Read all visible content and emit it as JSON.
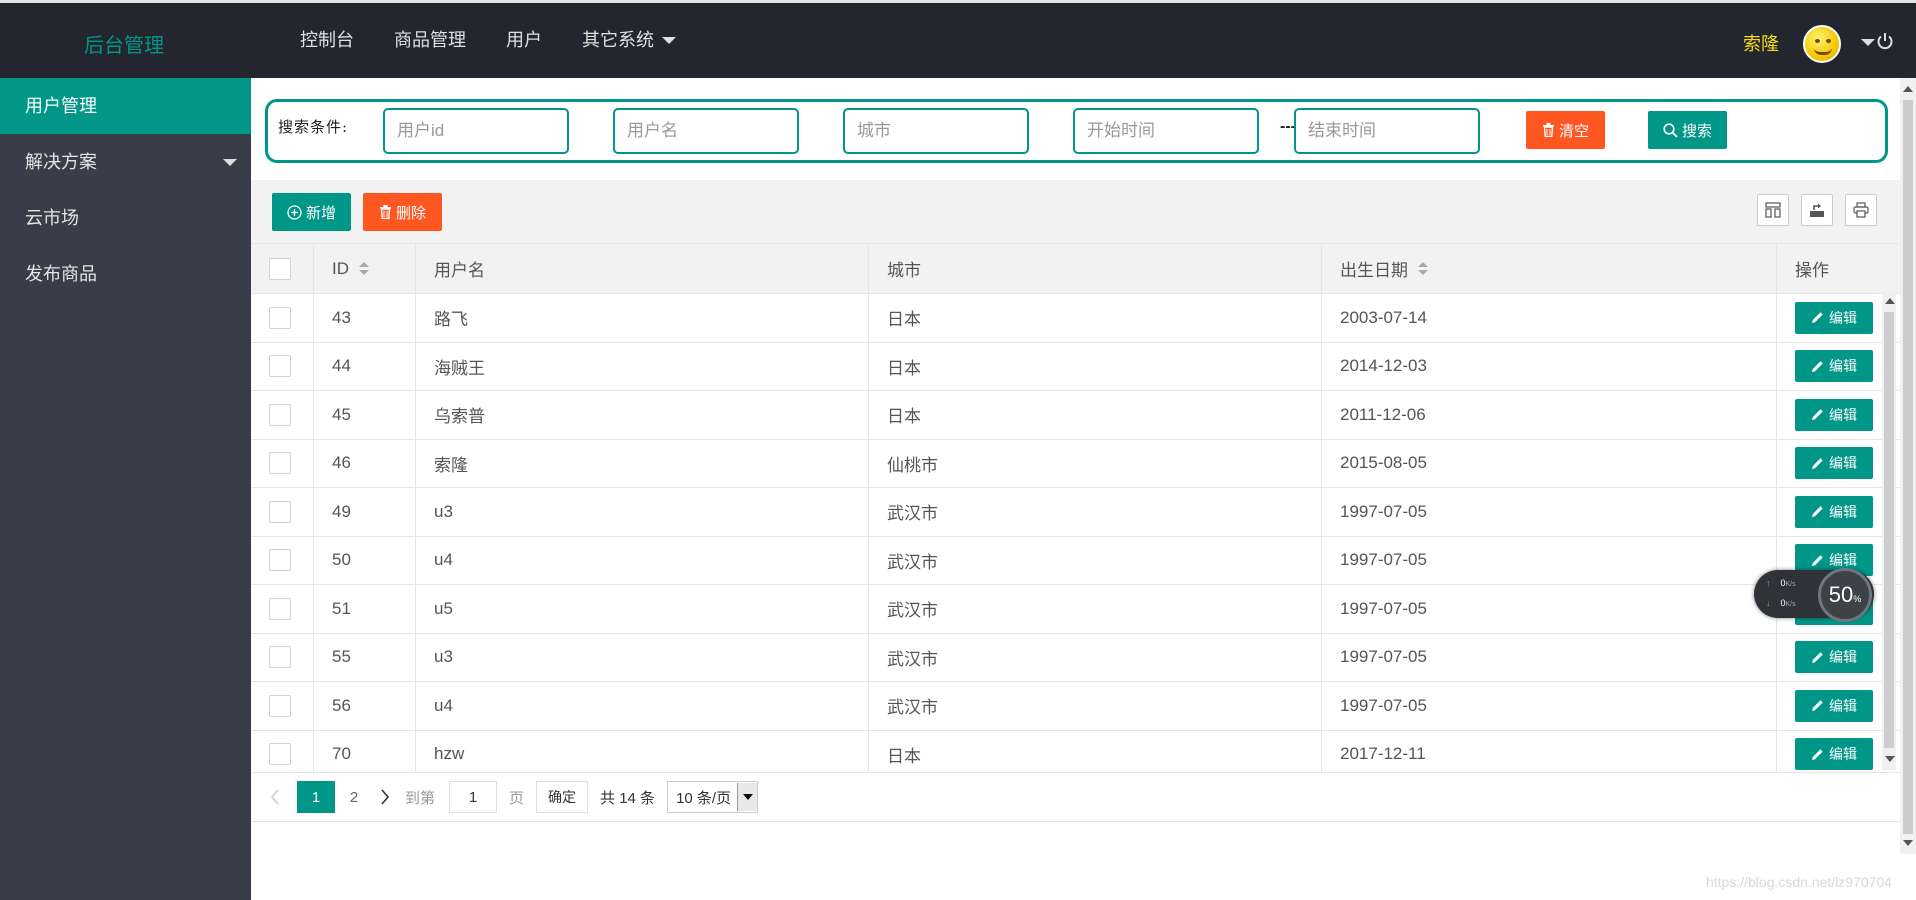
{
  "header": {
    "logo": "后台管理",
    "nav": [
      {
        "label": "控制台"
      },
      {
        "label": "商品管理"
      },
      {
        "label": "用户"
      },
      {
        "label": "其它系统",
        "has_dropdown": true
      }
    ],
    "user_name": "索隆"
  },
  "sidebar": {
    "items": [
      {
        "label": "用户管理",
        "active": true
      },
      {
        "label": "解决方案",
        "has_dropdown": true
      },
      {
        "label": "云市场"
      },
      {
        "label": "发布商品"
      }
    ]
  },
  "search": {
    "label": "搜索条件:",
    "user_id_placeholder": "用户id",
    "username_placeholder": "用户名",
    "city_placeholder": "城市",
    "start_time_placeholder": "开始时间",
    "separator": "----",
    "end_time_placeholder": "结束时间",
    "clear_label": "清空",
    "search_label": "搜索"
  },
  "toolbar": {
    "add_label": "新增",
    "delete_label": "删除"
  },
  "table": {
    "columns": [
      "ID",
      "用户名",
      "城市",
      "出生日期",
      "操作"
    ],
    "edit_label": "编辑",
    "rows": [
      {
        "id": "43",
        "name": "路飞",
        "city": "日本",
        "birth": "2003-07-14"
      },
      {
        "id": "44",
        "name": "海贼王",
        "city": "日本",
        "birth": "2014-12-03"
      },
      {
        "id": "45",
        "name": "乌索普",
        "city": "日本",
        "birth": "2011-12-06"
      },
      {
        "id": "46",
        "name": "索隆",
        "city": "仙桃市",
        "birth": "2015-08-05"
      },
      {
        "id": "49",
        "name": "u3",
        "city": "武汉市",
        "birth": "1997-07-05"
      },
      {
        "id": "50",
        "name": "u4",
        "city": "武汉市",
        "birth": "1997-07-05"
      },
      {
        "id": "51",
        "name": "u5",
        "city": "武汉市",
        "birth": "1997-07-05"
      },
      {
        "id": "55",
        "name": "u3",
        "city": "武汉市",
        "birth": "1997-07-05"
      },
      {
        "id": "56",
        "name": "u4",
        "city": "武汉市",
        "birth": "1997-07-05"
      },
      {
        "id": "70",
        "name": "hzw",
        "city": "日本",
        "birth": "2017-12-11"
      }
    ]
  },
  "pager": {
    "pages": [
      "1",
      "2"
    ],
    "current": "1",
    "goto_label": "到第",
    "goto_value": "1",
    "page_unit": "页",
    "confirm_label": "确定",
    "total_label": "共 14 条",
    "page_size": "10 条/页"
  },
  "widget": {
    "up_speed": "0",
    "down_speed": "0",
    "unit": "K/s",
    "percent": "50",
    "percent_sign": "%"
  },
  "watermark": "https://blog.csdn.net/lz970704",
  "colors": {
    "accent": "#009688",
    "danger": "#ff5722",
    "header_bg": "#23262e",
    "sidebar_bg": "#393d49",
    "user_name": "#f5dd1d"
  }
}
